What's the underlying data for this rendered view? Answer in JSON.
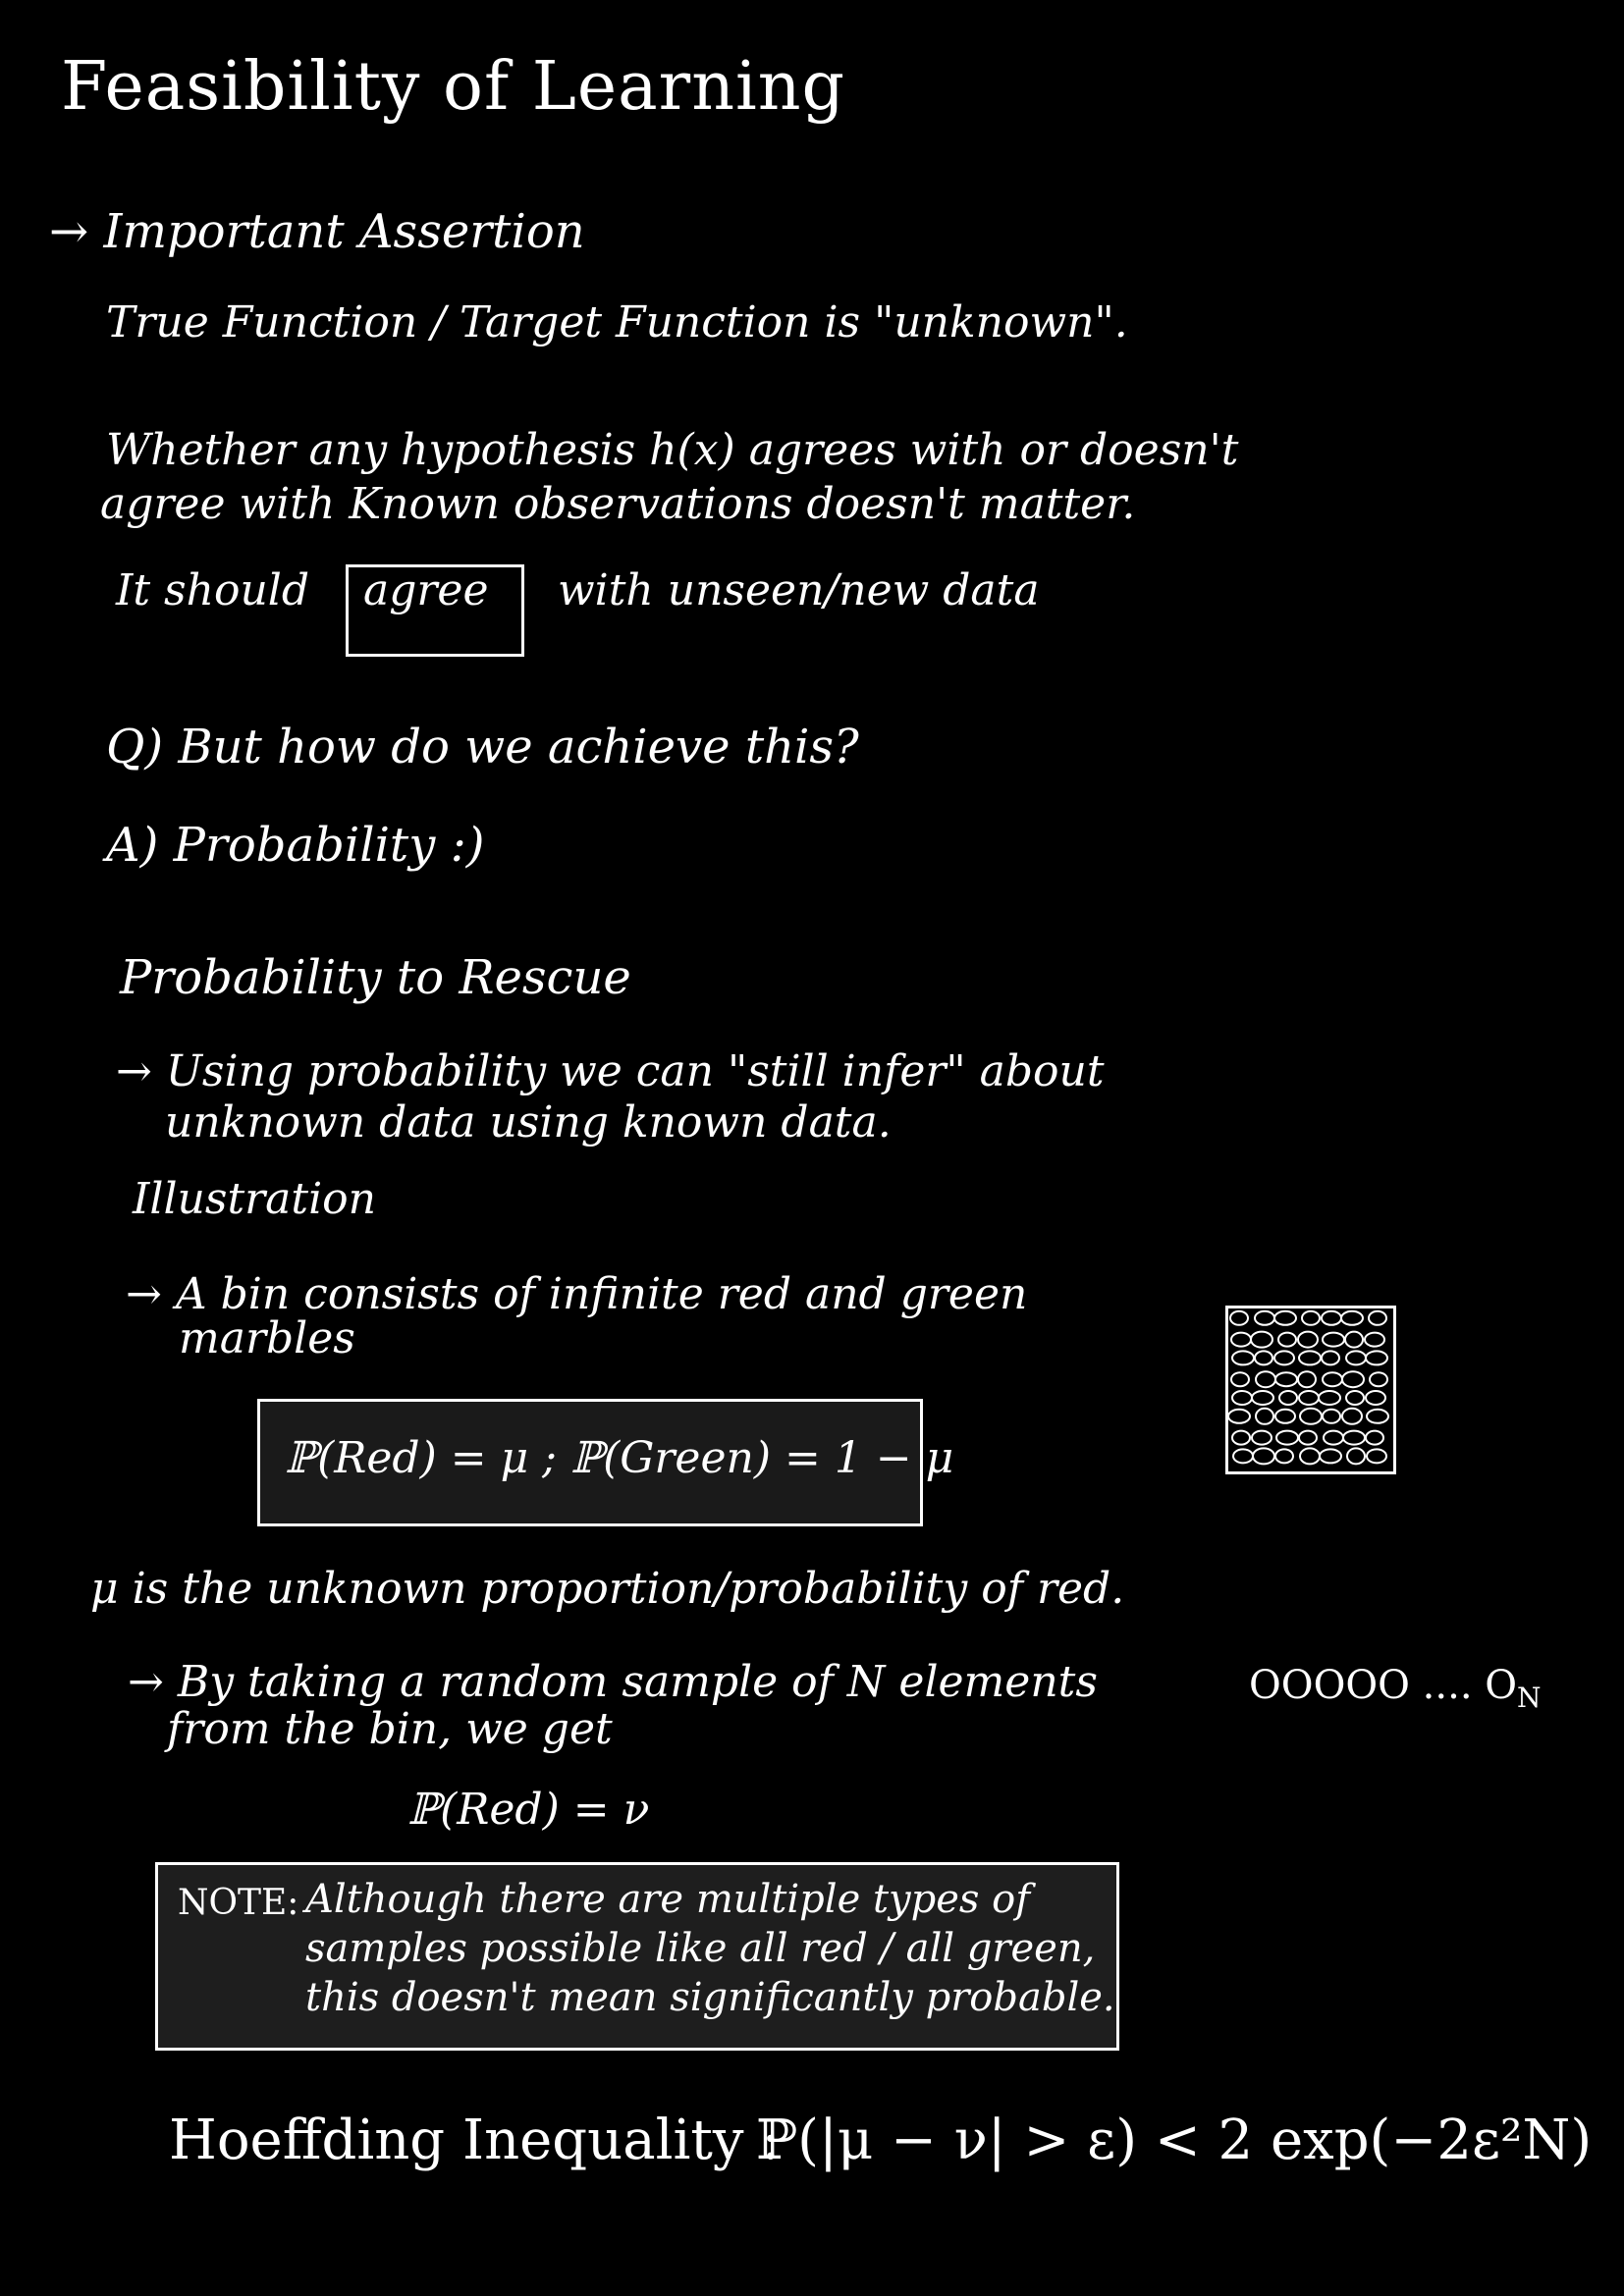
{
  "title": "Feasibility of Learning",
  "assertion": {
    "heading": "→ Important Assertion",
    "statement": "True Function / Target Function is \"unknown\".",
    "whether_line1": "Whether any hypothesis h(x) agrees with or doesn't",
    "whether_line2": "agree with Known observations doesn't matter.",
    "should_prefix": "It should",
    "should_boxed": "agree",
    "should_suffix": "with unseen/new data"
  },
  "qa": {
    "question": "Q) But how do we achieve this?",
    "answer": "A) Probability :)"
  },
  "rescue": {
    "heading": "Probability to Rescue",
    "line1": "→ Using probability we can \"still infer\" about",
    "line2": "unknown data using known data."
  },
  "illustration": {
    "heading": "Illustration",
    "bin_line1": "→ A bin consists of infinite red and green",
    "bin_line2": "marbles",
    "formula": "ℙ(Red) = μ ; ℙ(Green) = 1 − μ",
    "mu_note": "μ is the unknown proportion/probability of red.",
    "sample_line1": "→ By taking a random sample of N elements",
    "sample_line2": "from the bin, we get",
    "sample_seq": "OOOOO .... O",
    "sample_seq_sub": "N",
    "sample_prob": "ℙ(Red) = ν"
  },
  "note": {
    "label": "NOTE:",
    "line1": "Although there are multiple types of",
    "line2": "samples possible like all red / all green,",
    "line3": "this doesn't mean significantly probable."
  },
  "hoeffding": {
    "label": "Hoeffding Inequality :",
    "formula": "ℙ(|μ − ν| > ε) < 2 exp(−2ε²N)"
  }
}
